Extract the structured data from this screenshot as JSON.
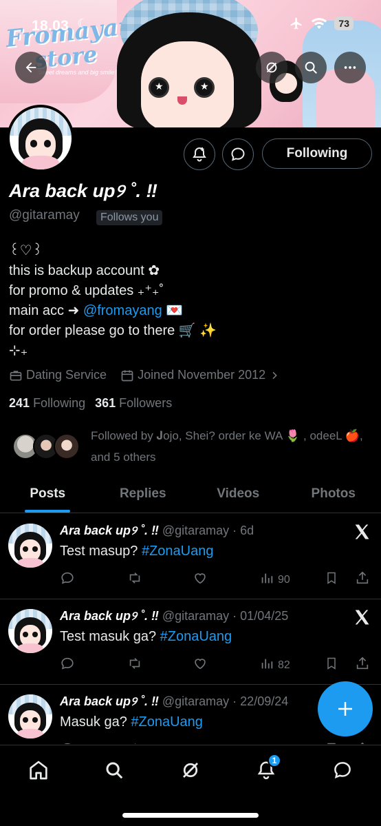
{
  "status_bar": {
    "time": "18.03",
    "battery": "73"
  },
  "banner": {
    "store_line1": "Fromayang",
    "store_line2": "store",
    "tagline": "sweet dreams and big smile!"
  },
  "profile": {
    "display_name": "Ara back up୨ ˚. ‼",
    "handle": "@gitaramay",
    "follows_you": "Follows you",
    "following_button": "Following",
    "bio": {
      "line1": "꒰♡꒱",
      "line2": "this is backup account ✿",
      "line3": "for promo & updates ₊⁺₊˚",
      "line4_prefix": "main acc ➜ ",
      "line4_link": "@fromayang",
      "line4_suffix": " 💌",
      "line5": "for order please go to there 🛒 ✨",
      "line6": "⊹₊"
    },
    "category": "Dating Service",
    "joined": "Joined November 2012",
    "following_count": "241",
    "following_label": "Following",
    "followers_count": "361",
    "followers_label": "Followers",
    "followed_by": "Followed by 𝐉ojo, Shei? order ke WA 🌷 , odeeL 🍎, and 5 others"
  },
  "tabs": [
    {
      "label": "Posts",
      "active": true
    },
    {
      "label": "Replies",
      "active": false
    },
    {
      "label": "Videos",
      "active": false
    },
    {
      "label": "Photos",
      "active": false
    }
  ],
  "posts": [
    {
      "name": "Ara back up୨ ˚. ‼",
      "meta": " @gitaramay · 6d",
      "text": "Test masup? ",
      "hashtag": "#ZonaUang",
      "views": "90"
    },
    {
      "name": "Ara back up୨ ˚. ‼",
      "meta": " @gitaramay · 01/04/25",
      "text": "Test masuk ga? ",
      "hashtag": "#ZonaUang",
      "views": "82"
    },
    {
      "name": "Ara back up୨ ˚. ‼",
      "meta": " @gitaramay · 22/09/24",
      "text": "Masuk ga? ",
      "hashtag": "#ZonaUang",
      "views": ""
    }
  ],
  "nav": {
    "notifications_badge": "1"
  },
  "colors": {
    "accent": "#1d9bf0",
    "background": "#000000",
    "muted": "#71767b",
    "text": "#e7e9ea"
  }
}
